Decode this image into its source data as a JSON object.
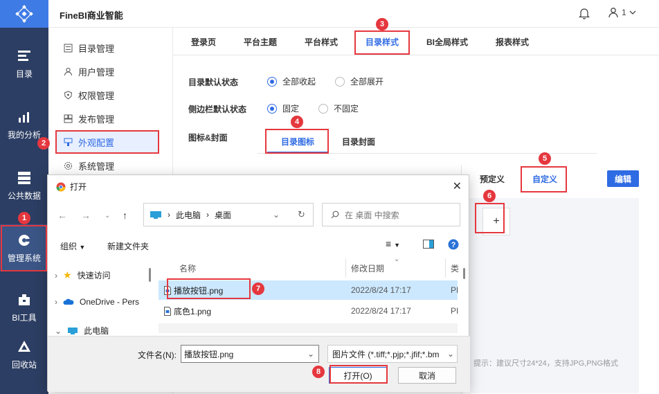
{
  "app": {
    "brand": "FineBI商业智能",
    "user_label": "1",
    "accent": "#2f6be3",
    "highlight": "#e5373e"
  },
  "leftnav": [
    {
      "label": "目录",
      "icon": "catalog-icon"
    },
    {
      "label": "我的分析",
      "icon": "analysis-icon"
    },
    {
      "label": "公共数据",
      "icon": "data-icon"
    },
    {
      "label": "管理系统",
      "icon": "gear-icon",
      "active": true
    },
    {
      "label": "BI工具",
      "icon": "toolbox-icon"
    },
    {
      "label": "回收站",
      "icon": "recycle-icon"
    }
  ],
  "subnav": [
    {
      "label": "目录管理"
    },
    {
      "label": "用户管理"
    },
    {
      "label": "权限管理"
    },
    {
      "label": "发布管理"
    },
    {
      "label": "外观配置",
      "active": true
    },
    {
      "label": "系统管理"
    }
  ],
  "tabs": [
    "登录页",
    "平台主题",
    "平台样式",
    "目录样式",
    "BI全局样式",
    "报表样式"
  ],
  "active_tab": "目录样式",
  "form": {
    "default_state_label": "目录默认状态",
    "collapse_all": "全部收起",
    "expand_all": "全部展开",
    "sidebar_state_label": "侧边栏默认状态",
    "fixed": "固定",
    "not_fixed": "不固定",
    "icon_cover_label": "图标&封面"
  },
  "subtabs": [
    "目录图标",
    "目录封面"
  ],
  "panel": {
    "preset": "预定义",
    "custom": "自定义",
    "edit": "编辑",
    "add": "+",
    "hint": "提示：建议尺寸24*24，支持JPG,PNG格式"
  },
  "badges": [
    "1",
    "2",
    "3",
    "4",
    "5",
    "6",
    "7",
    "8"
  ],
  "dialog": {
    "title": "打开",
    "path": [
      "此电脑",
      "桌面"
    ],
    "search_placeholder": "在 桌面 中搜索",
    "organize": "组织",
    "new_folder": "新建文件夹",
    "tree": [
      "快速访问",
      "OneDrive - Pers",
      "此电脑"
    ],
    "columns": {
      "name": "名称",
      "date": "修改日期",
      "type": "类"
    },
    "files": [
      {
        "name": "播放按钮.png",
        "date": "2022/8/24 17:17",
        "type": "PI",
        "selected": true
      },
      {
        "name": "底色1.png",
        "date": "2022/8/24 17:17",
        "type": "PI"
      }
    ],
    "filename_label": "文件名(N):",
    "filename_value": "播放按钮.png",
    "filetype": "图片文件 (*.tiff;*.pjp;*.jfif;*.bm",
    "open": "打开(O)",
    "cancel": "取消"
  }
}
